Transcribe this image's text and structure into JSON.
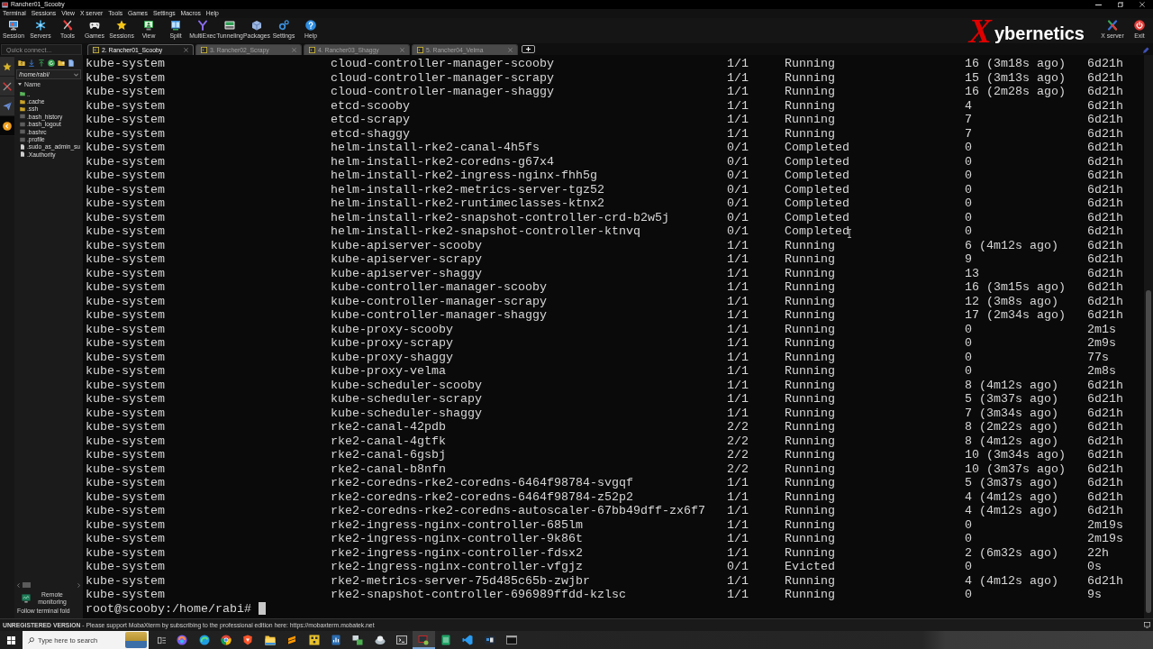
{
  "window": {
    "title": "Rancher01_Scooby"
  },
  "menu": [
    "Terminal",
    "Sessions",
    "View",
    "X server",
    "Tools",
    "Games",
    "Settings",
    "Macros",
    "Help"
  ],
  "toolbar": [
    {
      "label": "Session"
    },
    {
      "label": "Servers"
    },
    {
      "label": "Tools"
    },
    {
      "label": "Games"
    },
    {
      "label": "Sessions"
    },
    {
      "label": "View"
    },
    {
      "label": "Split"
    },
    {
      "label": "MultiExec"
    },
    {
      "label": "Tunneling"
    },
    {
      "label": "Packages"
    },
    {
      "label": "Settings"
    },
    {
      "label": "Help"
    }
  ],
  "logo": {
    "mark": "X",
    "text": "ybernetics"
  },
  "toolbar_right": [
    {
      "label": "X server"
    },
    {
      "label": "Exit"
    }
  ],
  "quick_connect": {
    "placeholder": "Quick connect..."
  },
  "tabs": [
    {
      "label": "2. Rancher01_Scooby",
      "selected": true
    },
    {
      "label": "3. Rancher02_Scrapy",
      "selected": false
    },
    {
      "label": "4. Rancher03_Shaggy",
      "selected": false
    },
    {
      "label": "5. Rancher04_Velma",
      "selected": false
    }
  ],
  "sidebar": {
    "side_tabs": [
      {
        "selected": false
      },
      {
        "selected": false
      },
      {
        "selected": false
      },
      {
        "selected": true
      }
    ],
    "path": "/home/rabi/",
    "tree_header": "Name",
    "files": [
      {
        "name": "..",
        "kind": "parent"
      },
      {
        "name": ".cache",
        "kind": "folder"
      },
      {
        "name": ".ssh",
        "kind": "folder"
      },
      {
        "name": ".bash_history",
        "kind": "dotfile"
      },
      {
        "name": ".bash_logout",
        "kind": "dotfile"
      },
      {
        "name": ".bashrc",
        "kind": "dotfile"
      },
      {
        "name": ".profile",
        "kind": "dotfile"
      },
      {
        "name": ".sudo_as_admin_su",
        "kind": "file"
      },
      {
        "name": ".Xauthority",
        "kind": "file"
      }
    ],
    "remote_monitoring": "Remote monitoring",
    "follow_terminal": "Follow terminal fold"
  },
  "terminal": {
    "rows": [
      [
        "kube-system",
        "cloud-controller-manager-scooby",
        "1/1",
        "Running",
        "16 (3m18s ago)",
        "6d21h"
      ],
      [
        "kube-system",
        "cloud-controller-manager-scrapy",
        "1/1",
        "Running",
        "15 (3m13s ago)",
        "6d21h"
      ],
      [
        "kube-system",
        "cloud-controller-manager-shaggy",
        "1/1",
        "Running",
        "16 (2m28s ago)",
        "6d21h"
      ],
      [
        "kube-system",
        "etcd-scooby",
        "1/1",
        "Running",
        "4",
        "6d21h"
      ],
      [
        "kube-system",
        "etcd-scrapy",
        "1/1",
        "Running",
        "7",
        "6d21h"
      ],
      [
        "kube-system",
        "etcd-shaggy",
        "1/1",
        "Running",
        "7",
        "6d21h"
      ],
      [
        "kube-system",
        "helm-install-rke2-canal-4h5fs",
        "0/1",
        "Completed",
        "0",
        "6d21h"
      ],
      [
        "kube-system",
        "helm-install-rke2-coredns-g67x4",
        "0/1",
        "Completed",
        "0",
        "6d21h"
      ],
      [
        "kube-system",
        "helm-install-rke2-ingress-nginx-fhh5g",
        "0/1",
        "Completed",
        "0",
        "6d21h"
      ],
      [
        "kube-system",
        "helm-install-rke2-metrics-server-tgz52",
        "0/1",
        "Completed",
        "0",
        "6d21h"
      ],
      [
        "kube-system",
        "helm-install-rke2-runtimeclasses-ktnx2",
        "0/1",
        "Completed",
        "0",
        "6d21h"
      ],
      [
        "kube-system",
        "helm-install-rke2-snapshot-controller-crd-b2w5j",
        "0/1",
        "Completed",
        "0",
        "6d21h"
      ],
      [
        "kube-system",
        "helm-install-rke2-snapshot-controller-ktnvq",
        "0/1",
        "Completed",
        "0",
        "6d21h"
      ],
      [
        "kube-system",
        "kube-apiserver-scooby",
        "1/1",
        "Running",
        "6 (4m12s ago)",
        "6d21h"
      ],
      [
        "kube-system",
        "kube-apiserver-scrapy",
        "1/1",
        "Running",
        "9",
        "6d21h"
      ],
      [
        "kube-system",
        "kube-apiserver-shaggy",
        "1/1",
        "Running",
        "13",
        "6d21h"
      ],
      [
        "kube-system",
        "kube-controller-manager-scooby",
        "1/1",
        "Running",
        "16 (3m15s ago)",
        "6d21h"
      ],
      [
        "kube-system",
        "kube-controller-manager-scrapy",
        "1/1",
        "Running",
        "12 (3m8s ago)",
        "6d21h"
      ],
      [
        "kube-system",
        "kube-controller-manager-shaggy",
        "1/1",
        "Running",
        "17 (2m34s ago)",
        "6d21h"
      ],
      [
        "kube-system",
        "kube-proxy-scooby",
        "1/1",
        "Running",
        "0",
        "2m1s"
      ],
      [
        "kube-system",
        "kube-proxy-scrapy",
        "1/1",
        "Running",
        "0",
        "2m9s"
      ],
      [
        "kube-system",
        "kube-proxy-shaggy",
        "1/1",
        "Running",
        "0",
        "77s"
      ],
      [
        "kube-system",
        "kube-proxy-velma",
        "1/1",
        "Running",
        "0",
        "2m8s"
      ],
      [
        "kube-system",
        "kube-scheduler-scooby",
        "1/1",
        "Running",
        "8 (4m12s ago)",
        "6d21h"
      ],
      [
        "kube-system",
        "kube-scheduler-scrapy",
        "1/1",
        "Running",
        "5 (3m37s ago)",
        "6d21h"
      ],
      [
        "kube-system",
        "kube-scheduler-shaggy",
        "1/1",
        "Running",
        "7 (3m34s ago)",
        "6d21h"
      ],
      [
        "kube-system",
        "rke2-canal-42pdb",
        "2/2",
        "Running",
        "8 (2m22s ago)",
        "6d21h"
      ],
      [
        "kube-system",
        "rke2-canal-4gtfk",
        "2/2",
        "Running",
        "8 (4m12s ago)",
        "6d21h"
      ],
      [
        "kube-system",
        "rke2-canal-6gsbj",
        "2/2",
        "Running",
        "10 (3m34s ago)",
        "6d21h"
      ],
      [
        "kube-system",
        "rke2-canal-b8nfn",
        "2/2",
        "Running",
        "10 (3m37s ago)",
        "6d21h"
      ],
      [
        "kube-system",
        "rke2-coredns-rke2-coredns-6464f98784-svgqf",
        "1/1",
        "Running",
        "5 (3m37s ago)",
        "6d21h"
      ],
      [
        "kube-system",
        "rke2-coredns-rke2-coredns-6464f98784-z52p2",
        "1/1",
        "Running",
        "4 (4m12s ago)",
        "6d21h"
      ],
      [
        "kube-system",
        "rke2-coredns-rke2-coredns-autoscaler-67bb49dff-zx6f7",
        "1/1",
        "Running",
        "4 (4m12s ago)",
        "6d21h"
      ],
      [
        "kube-system",
        "rke2-ingress-nginx-controller-685lm",
        "1/1",
        "Running",
        "0",
        "2m19s"
      ],
      [
        "kube-system",
        "rke2-ingress-nginx-controller-9k86t",
        "1/1",
        "Running",
        "0",
        "2m19s"
      ],
      [
        "kube-system",
        "rke2-ingress-nginx-controller-fdsx2",
        "1/1",
        "Running",
        "2 (6m32s ago)",
        "22h"
      ],
      [
        "kube-system",
        "rke2-ingress-nginx-controller-vfgjz",
        "0/1",
        "Evicted",
        "0",
        "0s"
      ],
      [
        "kube-system",
        "rke2-metrics-server-75d485c65b-zwjbr",
        "1/1",
        "Running",
        "4 (4m12s ago)",
        "6d21h"
      ],
      [
        "kube-system",
        "rke2-snapshot-controller-696989ffdd-kzlsc",
        "1/1",
        "Running",
        "0",
        "9s"
      ]
    ],
    "prompt": "root@scooby:/home/rabi#"
  },
  "status_bar": {
    "message": "**UNREGISTERED VERSION** - Please support MobaXterm by subscribing to the professional edition here: ",
    "link": "https://mobaxterm.mobatek.net"
  },
  "taskbar": {
    "search": {
      "placeholder": "Type here to search"
    },
    "apps": [
      {
        "selected": false
      },
      {
        "selected": false
      },
      {
        "selected": false
      },
      {
        "selected": false
      },
      {
        "selected": false
      },
      {
        "selected": false
      },
      {
        "selected": false
      },
      {
        "selected": false
      },
      {
        "selected": false
      },
      {
        "selected": false
      },
      {
        "selected": false
      },
      {
        "selected": true
      },
      {
        "selected": false
      },
      {
        "selected": false
      },
      {
        "selected": false
      },
      {
        "selected": false
      }
    ]
  }
}
